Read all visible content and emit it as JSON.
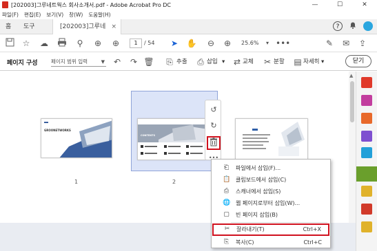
{
  "window": {
    "title": "[202003]그루네트웍스 회사소개서.pdf - Adobe Acrobat Pro DC",
    "minimize": "—",
    "maximize": "☐",
    "close": "✕"
  },
  "menubar": {
    "items": [
      "파일(F)",
      "편집(E)",
      "보기(V)",
      "창(W)",
      "도움말(H)"
    ]
  },
  "tabs": {
    "home": "홈",
    "tools": "도구",
    "document": "[202003]그루네트...",
    "close": "×"
  },
  "toolbar": {
    "current_page": "1",
    "total_pages": "/ 54",
    "zoom": "25.6%"
  },
  "organize": {
    "label": "페이지 구성",
    "range_placeholder": "페이지 범위 입력",
    "extract": "추출",
    "insert": "삽입",
    "replace": "교체",
    "split": "분할",
    "more": "자세히",
    "close": "닫기"
  },
  "pages": [
    {
      "number": "1",
      "brand": "GROONETWORKS"
    },
    {
      "number": "2",
      "heading": "CONTENTS"
    },
    {
      "number": "3"
    }
  ],
  "context_menu": {
    "items": [
      {
        "label": "파일에서 삽입(F)...",
        "icon": "file-insert-icon"
      },
      {
        "label": "클립보드에서 삽입(C)",
        "icon": "clipboard-icon"
      },
      {
        "label": "스캐너에서 삽입(S)",
        "icon": "scanner-icon"
      },
      {
        "label": "웹 페이지로부터 삽입(W)...",
        "icon": "web-page-icon"
      },
      {
        "label": "빈 페이지 삽입(B)",
        "icon": "blank-page-icon"
      }
    ],
    "cut": {
      "label": "잘라내기(T)",
      "shortcut": "Ctrl+X"
    },
    "copy": {
      "label": "복사(C)",
      "shortcut": "Ctrl+C"
    }
  },
  "colors": {
    "accent_red": "#d0101d",
    "selection_blue": "#dce4f8",
    "rail_green": "#6a9f2c"
  }
}
